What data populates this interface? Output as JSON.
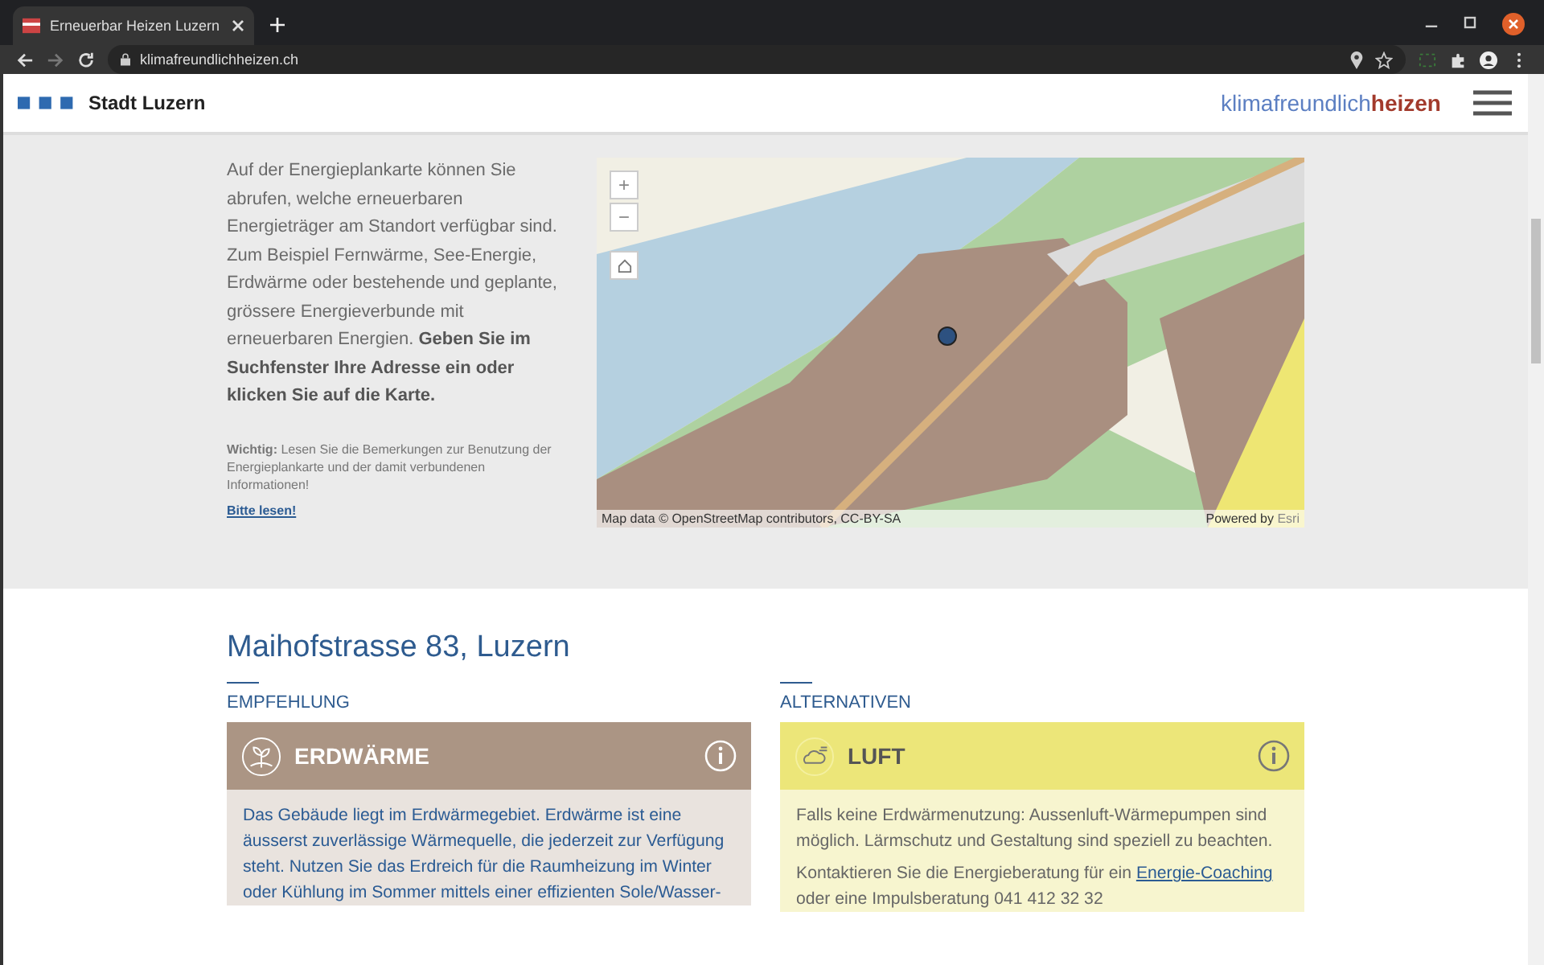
{
  "browser": {
    "tab_title": "Erneuerbar Heizen Luzern",
    "url": "klimafreundlichheizen.ch"
  },
  "header": {
    "brand": "Stadt Luzern",
    "logo_light": "klimafreundlich",
    "logo_bold": "heizen"
  },
  "intro": {
    "text": "Auf der Energieplankarte können Sie abrufen, welche erneuerbaren Energieträger am Standort verfügbar sind. Zum Beispiel Fernwärme, See-Energie, Erdwärme oder bestehende und geplante, grössere Energieverbunde mit erneuerbaren Energien.  **Geben Sie im Suchfenster Ihre Adresse ein oder klicken Sie auf die Karte.**",
    "note": "**Wichtig:** Lesen Sie die Bemerkungen zur Benutzung der Energieplankarte und der damit verbundenen Informationen!",
    "note_link": "Bitte lesen!"
  },
  "map": {
    "zoom_in": "+",
    "zoom_out": "−",
    "attribution": "Map data © OpenStreetMap contributors, CC-BY-SA",
    "powered_by": "Powered by",
    "esri": "Esri"
  },
  "address": "Maihofstrasse 83, Luzern",
  "columns": [
    {
      "heading": "EMPFEHLUNG",
      "card": {
        "kind": "earth",
        "title": "ERDWÄRME",
        "paragraphs": [
          {
            "text": "Das Gebäude liegt im Erdwärmegebiet. Erdwärme ist eine äusserst zuverlässige Wärmequelle, die jederzeit zur Verfügung steht. Nutzen Sie das Erdreich für die Raumheizung im Winter oder Kühlung im Sommer mittels einer effizienten Sole/Wasser-"
          }
        ]
      }
    },
    {
      "heading": "ALTERNATIVEN",
      "card": {
        "kind": "air",
        "title": "LUFT",
        "paragraphs": [
          {
            "text": "Falls keine Erdwärmenutzung: Aussenluft-Wärmepumpen sind möglich. Lärmschutz und Gestaltung sind speziell zu beachten."
          },
          {
            "text": "Kontaktieren Sie die Energieberatung für ein",
            "link": "Energie-Coaching",
            "after": "oder eine Impulsberatung 041 412 32 32"
          }
        ]
      }
    }
  ]
}
